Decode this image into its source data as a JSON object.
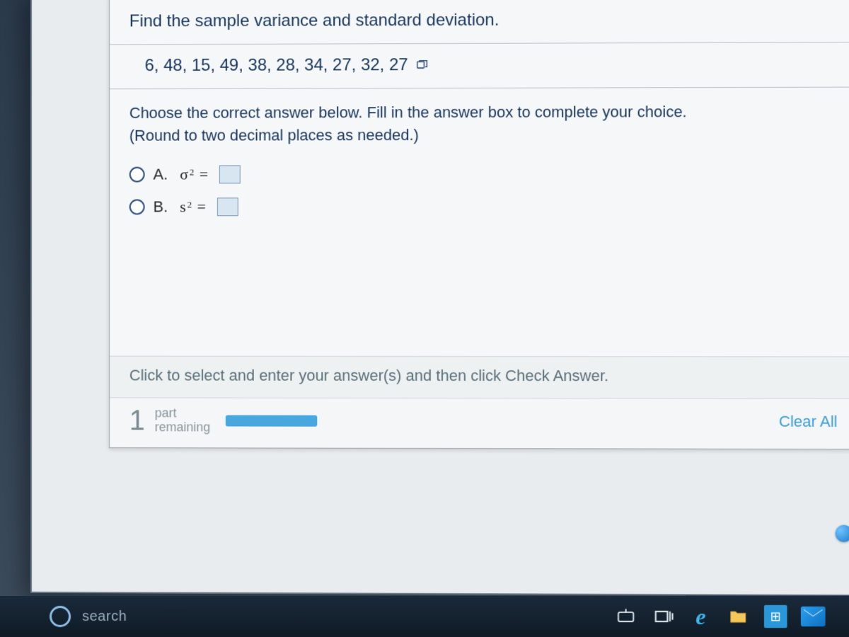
{
  "question": {
    "prompt": "Find the sample variance and standard deviation.",
    "data_set": "6, 48, 15, 49, 38, 28, 34, 27, 32, 27",
    "instruction_line1": "Choose the correct answer below. Fill in the answer box to complete your choice.",
    "instruction_line2": "(Round to two decimal places as needed.)",
    "choices": {
      "a": {
        "label": "A.",
        "symbol": "σ",
        "value": ""
      },
      "b": {
        "label": "B.",
        "symbol": "s",
        "value": ""
      }
    },
    "hint": "Click to select and enter your answer(s) and then click Check Answer."
  },
  "progress": {
    "count": "1",
    "part_label": "part",
    "remaining_label": "remaining",
    "clear_all": "Clear All"
  },
  "taskbar": {
    "search_hint": "search"
  }
}
